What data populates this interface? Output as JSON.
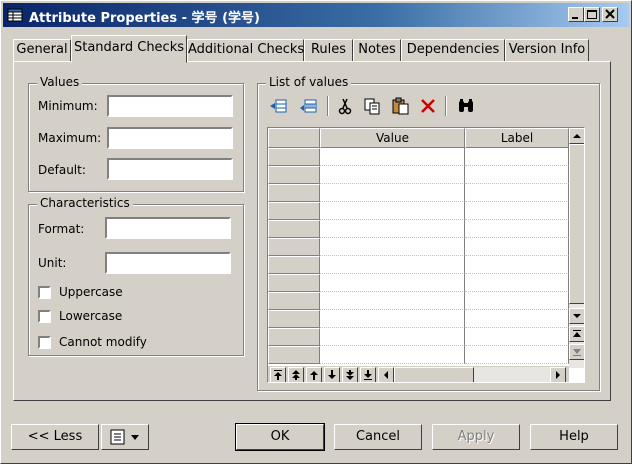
{
  "window": {
    "title": "Attribute Properties - 学号 (学号)"
  },
  "title_buttons": [
    "minimize",
    "maximize",
    "close"
  ],
  "tabs": [
    {
      "label": "General"
    },
    {
      "label": "Standard Checks",
      "active": true
    },
    {
      "label": "Additional Checks"
    },
    {
      "label": "Rules"
    },
    {
      "label": "Notes"
    },
    {
      "label": "Dependencies"
    },
    {
      "label": "Version Info"
    }
  ],
  "values_group": {
    "title": "Values",
    "minimum_label": "Minimum:",
    "minimum_value": "",
    "maximum_label": "Maximum:",
    "maximum_value": "",
    "default_label": "Default:",
    "default_value": ""
  },
  "characteristics_group": {
    "title": "Characteristics",
    "format_label": "Format:",
    "format_value": "",
    "unit_label": "Unit:",
    "unit_value": "",
    "uppercase_label": "Uppercase",
    "uppercase_checked": false,
    "lowercase_label": "Lowercase",
    "lowercase_checked": false,
    "cannot_modify_label": "Cannot modify",
    "cannot_modify_checked": false
  },
  "list_of_values": {
    "title": "List of values",
    "toolbar_icons": [
      "add-rows-icon",
      "insert-row-icon",
      "cut-icon",
      "copy-icon",
      "paste-icon",
      "delete-icon",
      "find-icon"
    ],
    "columns": [
      "Value",
      "Label"
    ],
    "rows": [
      [
        "",
        ""
      ],
      [
        "",
        ""
      ],
      [
        "",
        ""
      ],
      [
        "",
        ""
      ],
      [
        "",
        ""
      ],
      [
        "",
        ""
      ],
      [
        "",
        ""
      ],
      [
        "",
        ""
      ],
      [
        "",
        ""
      ],
      [
        "",
        ""
      ],
      [
        "",
        ""
      ],
      [
        "",
        ""
      ]
    ],
    "nav_icons": [
      "move-top-icon",
      "move-up-page-icon",
      "move-up-icon",
      "move-down-icon",
      "move-down-page-icon",
      "move-bottom-icon"
    ]
  },
  "buttons": {
    "less": "<< Less",
    "ok": "OK",
    "cancel": "Cancel",
    "apply": "Apply",
    "help": "Help"
  },
  "colors": {
    "face": "#d4d0c8",
    "title_start": "#0a246a",
    "title_end": "#a6caf0",
    "delete_red": "#d00000"
  }
}
